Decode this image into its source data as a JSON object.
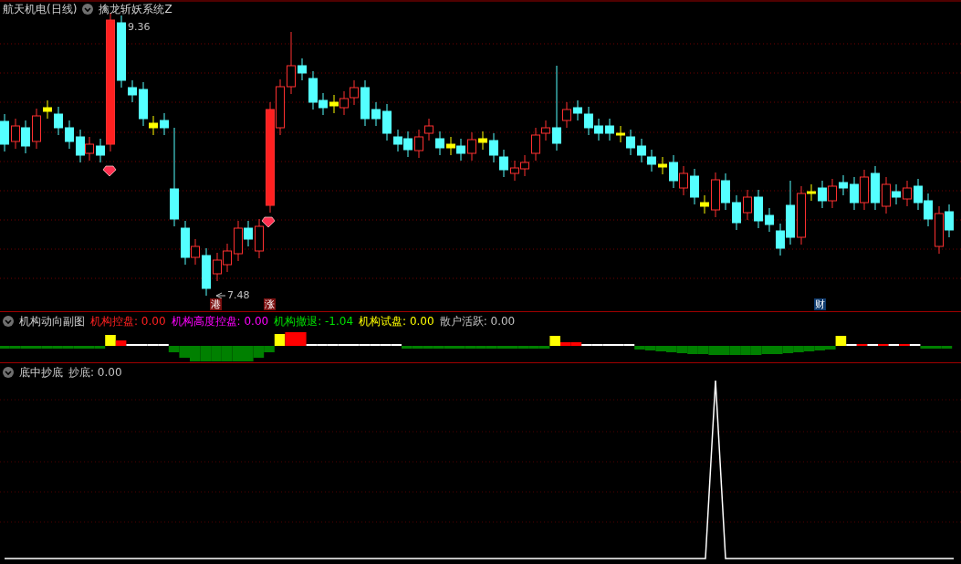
{
  "main_panel": {
    "title": "航天机电(日线)",
    "indicator": "擒龙斩妖系统Z",
    "high_label": "9.36",
    "low_label": "7.48",
    "markers": [
      {
        "text": "港",
        "color": "#7a1010"
      },
      {
        "text": "涨",
        "color": "#7a1010"
      },
      {
        "text": "财",
        "color": "#0f3b6e"
      }
    ]
  },
  "sub_panel": {
    "title": "机构动向副图",
    "items": [
      {
        "text": "机构控盘: 0.00",
        "color": "#ff2020"
      },
      {
        "text": "机构高度控盘: 0.00",
        "color": "#ff00ff"
      },
      {
        "text": "机构撤退: -1.04",
        "color": "#00e000"
      },
      {
        "text": "机构试盘: 0.00",
        "color": "#ffff00"
      },
      {
        "text": "散户活跃: 0.00",
        "color": "#c0c0c0"
      }
    ]
  },
  "bottom_panel": {
    "title": "底中抄底",
    "items": [
      {
        "text": "抄底: 0.00",
        "color": "#c0c0c0"
      }
    ]
  }
}
